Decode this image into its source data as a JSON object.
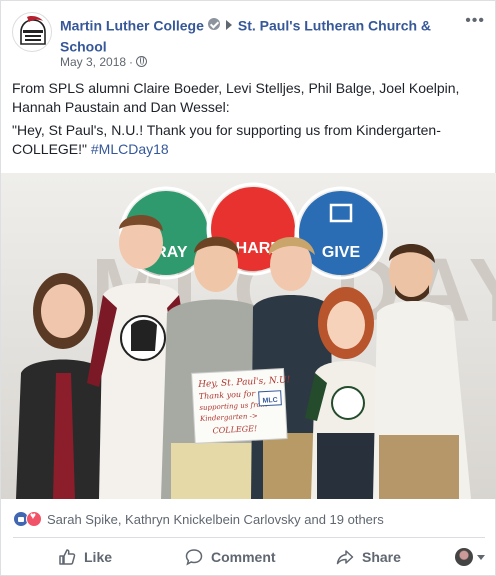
{
  "post": {
    "author": "Martin Luther College",
    "target_page": "St. Paul's Lutheran Church & School",
    "date": "May 3, 2018",
    "privacy_icon": "globe-icon",
    "message_line1": "From SPLS alumni Claire Boeder, Levi Stelljes, Phil Balge, Joel Koelpin, Hannah Paustain and Dan Wessel:",
    "message_line2": "\"Hey, St Paul's, N.U.! Thank you for supporting us from Kindergarten-COLLEGE!\"",
    "hashtag": "#MLCDay18"
  },
  "photo": {
    "banner_words": [
      "PRAY",
      "SHARE",
      "GIVE"
    ],
    "banner_big_text": "MLC DAY",
    "sign_text": [
      "Hey, St. Paul's, N.U!",
      "Thank you for",
      "supporting us from",
      "Kindergarten ->",
      "COLLEGE!"
    ],
    "sign_logo": "MLC"
  },
  "reactions": {
    "summary": "Sarah Spike, Kathryn Knickelbein Carlovsky and 19 others"
  },
  "actions": {
    "like": "Like",
    "comment": "Comment",
    "share": "Share"
  },
  "colors": {
    "link": "#365899",
    "like_blue": "#4267b2",
    "love_red": "#f25268",
    "muted": "#606770",
    "pray_green": "#2e9a6e",
    "share_red": "#e8322f",
    "give_blue": "#2a6db5"
  }
}
